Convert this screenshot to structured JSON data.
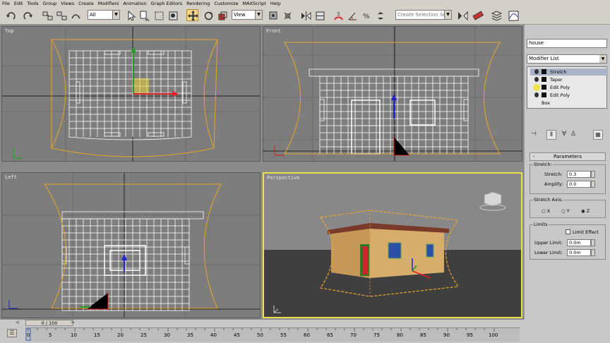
{
  "menu": [
    "File",
    "Edit",
    "Tools",
    "Group",
    "Views",
    "Create",
    "Modifiers",
    "Animation",
    "Graph Editors",
    "Rendering",
    "Customize",
    "MAXScript",
    "Help"
  ],
  "toolbar": {
    "selection_filter": "All",
    "ref_coord": "View",
    "named_selection_placeholder": "Create Selection Se"
  },
  "viewports": {
    "top": "Top",
    "front": "Front",
    "left": "Left",
    "perspective": "Perspective"
  },
  "command_panel": {
    "object_name": "house",
    "modifier_list_label": "Modifier List",
    "stack": [
      "Stretch",
      "Taper",
      "Edit Poly",
      "Edit Poly",
      "Box"
    ],
    "parameters_title": "Parameters",
    "stretch_group": "Stretch:",
    "stretch_label": "Stretch:",
    "stretch_value": "0.3",
    "amplify_label": "Amplify:",
    "amplify_value": "0.0",
    "axis_group": "Stretch Axis:",
    "axis_x": "X",
    "axis_y": "Y",
    "axis_z": "Z",
    "selected_axis": "Z",
    "limits_group": "Limits",
    "limit_effect": "Limit Effect",
    "upper_label": "Upper Limit:",
    "upper_value": "0.0m",
    "lower_label": "Lower Limit:",
    "lower_value": "0.0m"
  },
  "timeline": {
    "frame_display": "0 / 100",
    "ticks": [
      "0",
      "5",
      "10",
      "15",
      "20",
      "25",
      "30",
      "35",
      "40",
      "45",
      "50",
      "55",
      "60",
      "65",
      "70",
      "75",
      "80",
      "85",
      "90",
      "95",
      "100"
    ]
  },
  "colors": {
    "viewport_bg": "#7d7d7d",
    "active_border": "#e9e24f",
    "gizmo": "#e8a628",
    "mesh": "#ffffff"
  }
}
